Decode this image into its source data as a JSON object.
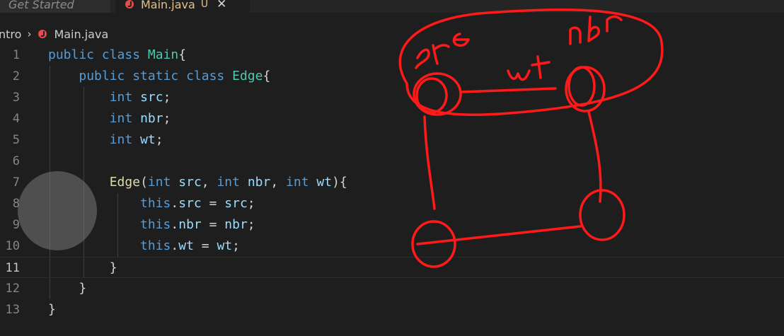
{
  "tabs": [
    {
      "label": "Get Started",
      "active": false
    },
    {
      "label": "Main.java",
      "active": true,
      "status": "U"
    }
  ],
  "breadcrumb": {
    "folder": "ntro",
    "file": "Main.java"
  },
  "editor": {
    "current_line": 11,
    "lines": [
      {
        "n": "1",
        "tokens": [
          [
            "kw",
            "public "
          ],
          [
            "kw",
            "class "
          ],
          [
            "ty",
            "Main"
          ],
          [
            "pn",
            "{"
          ]
        ]
      },
      {
        "n": "2",
        "tokens": [
          [
            "pn",
            "    "
          ],
          [
            "kw",
            "public "
          ],
          [
            "kw",
            "static "
          ],
          [
            "kw",
            "class "
          ],
          [
            "ty",
            "Edge"
          ],
          [
            "pn",
            "{"
          ]
        ]
      },
      {
        "n": "3",
        "tokens": [
          [
            "pn",
            "        "
          ],
          [
            "kw",
            "int "
          ],
          [
            "id",
            "src"
          ],
          [
            "pn",
            ";"
          ]
        ]
      },
      {
        "n": "4",
        "tokens": [
          [
            "pn",
            "        "
          ],
          [
            "kw",
            "int "
          ],
          [
            "id",
            "nbr"
          ],
          [
            "pn",
            ";"
          ]
        ]
      },
      {
        "n": "5",
        "tokens": [
          [
            "pn",
            "        "
          ],
          [
            "kw",
            "int "
          ],
          [
            "id",
            "wt"
          ],
          [
            "pn",
            ";"
          ]
        ]
      },
      {
        "n": "6",
        "tokens": []
      },
      {
        "n": "7",
        "tokens": [
          [
            "pn",
            "        "
          ],
          [
            "fn",
            "Edge"
          ],
          [
            "pn",
            "("
          ],
          [
            "kw",
            "int "
          ],
          [
            "id",
            "src"
          ],
          [
            "pn",
            ", "
          ],
          [
            "kw",
            "int "
          ],
          [
            "id",
            "nbr"
          ],
          [
            "pn",
            ", "
          ],
          [
            "kw",
            "int "
          ],
          [
            "id",
            "wt"
          ],
          [
            "pn",
            "){"
          ]
        ]
      },
      {
        "n": "8",
        "tokens": [
          [
            "pn",
            "            "
          ],
          [
            "kw",
            "this"
          ],
          [
            "pn",
            "."
          ],
          [
            "id",
            "src"
          ],
          [
            "pn",
            " = "
          ],
          [
            "id",
            "src"
          ],
          [
            "pn",
            ";"
          ]
        ]
      },
      {
        "n": "9",
        "tokens": [
          [
            "pn",
            "            "
          ],
          [
            "kw",
            "this"
          ],
          [
            "pn",
            "."
          ],
          [
            "id",
            "nbr"
          ],
          [
            "pn",
            " = "
          ],
          [
            "id",
            "nbr"
          ],
          [
            "pn",
            ";"
          ]
        ]
      },
      {
        "n": "10",
        "tokens": [
          [
            "pn",
            "            "
          ],
          [
            "kw",
            "this"
          ],
          [
            "pn",
            "."
          ],
          [
            "id",
            "wt"
          ],
          [
            "pn",
            " = "
          ],
          [
            "id",
            "wt"
          ],
          [
            "pn",
            ";"
          ]
        ]
      },
      {
        "n": "11",
        "tokens": [
          [
            "pn",
            "        }"
          ]
        ]
      },
      {
        "n": "12",
        "tokens": [
          [
            "pn",
            "    }"
          ]
        ]
      },
      {
        "n": "13",
        "tokens": [
          [
            "pn",
            "}"
          ]
        ]
      }
    ]
  },
  "annotation": {
    "color": "#ff1a1a",
    "labels": {
      "src": "src",
      "weight": "wt",
      "neighbor": "nbr"
    }
  }
}
